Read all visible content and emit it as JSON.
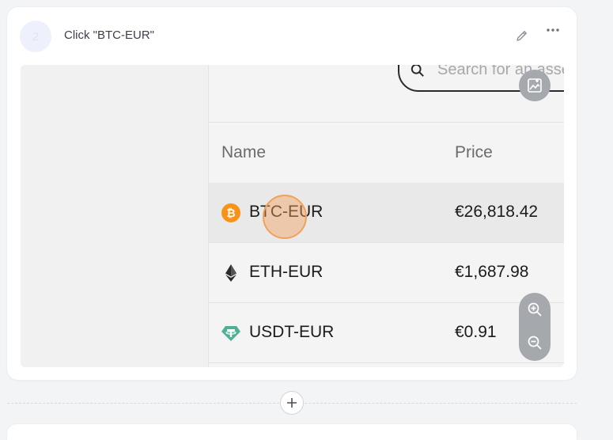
{
  "step": {
    "number": "2",
    "title": "Click \"BTC-EUR\""
  },
  "icons": {
    "edit": "pencil-icon",
    "more": "more-horizontal-icon",
    "image": "image-edit-icon",
    "zoom_in": "zoom-in-icon",
    "zoom_out": "zoom-out-icon",
    "add": "plus-icon"
  },
  "screenshot": {
    "search": {
      "placeholder": "Search for an asset"
    },
    "table": {
      "columns": [
        "Name",
        "Price"
      ],
      "rows": [
        {
          "pair": "BTC-EUR",
          "price": "€26,818.42",
          "icon": "bitcoin-icon",
          "selected": true
        },
        {
          "pair": "ETH-EUR",
          "price": "€1,687.98",
          "icon": "ethereum-icon",
          "selected": false
        },
        {
          "pair": "USDT-EUR",
          "price": "€0.91",
          "icon": "tether-icon",
          "selected": false
        }
      ]
    }
  },
  "colors": {
    "bitcoin": "#f7931a",
    "tether": "#50af95",
    "click_highlight": "#f3a060",
    "overlay_buttons": "#a5a8ad"
  }
}
